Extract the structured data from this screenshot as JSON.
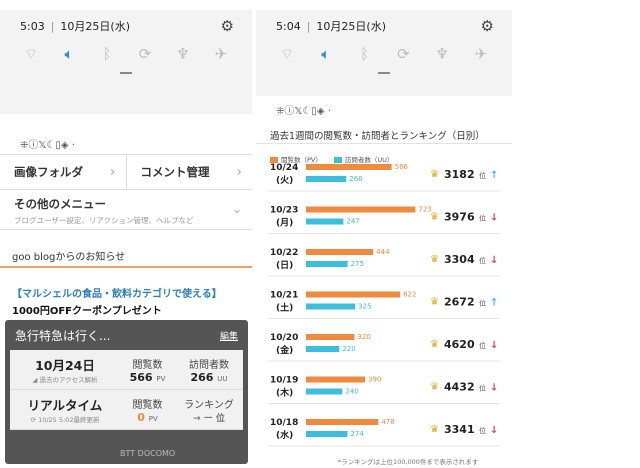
{
  "left": {
    "status": {
      "time": "5:03",
      "date": "10月25日(水)"
    },
    "notif_icons": "⁜ⓘ𝕏☾▯◈ ·",
    "grid": [
      {
        "label": "画像フォルダ"
      },
      {
        "label": "コメント管理"
      }
    ],
    "other_menu": {
      "title": "その他のメニュー",
      "subtitle": "ブログユーザー設定、リアクション管理、ヘルプなど"
    },
    "notice": "goo blogからのお知らせ",
    "promo": {
      "line1": "【マルシェルの食品・飲料カテゴリで使える】",
      "line2": "1000円OFFクーポンプレゼント"
    },
    "box": {
      "title": "急行特急は行く...",
      "edit": "編集",
      "row1": {
        "date": "10月24日",
        "sub": "過去のアクセス解析",
        "pv_label": "閲覧数",
        "pv_value": "566",
        "pv_unit": "PV",
        "uu_label": "訪問者数",
        "uu_value": "266",
        "uu_unit": "UU"
      },
      "row2": {
        "title": "リアルタイム",
        "sub": "10/25 5:02最終更新",
        "pv_label": "閲覧数",
        "pv_value": "0",
        "pv_unit": "PV",
        "rank_label": "ランキング",
        "rank_value": "→ ー 位"
      }
    },
    "watermark": "BTT DOCOMO"
  },
  "right": {
    "status": {
      "time": "5:04",
      "date": "10月25日(水)"
    },
    "notif_icons": "⁜ⓘ𝕏☾▯◈ ·",
    "title": "過去1週間の閲覧数・訪問者とランキング（日別）",
    "legend": {
      "pv": "閲覧数（PV）",
      "uu": "訪問者数（UU）"
    },
    "footnote": "*ランキングは上位100,000件まで表示されます"
  },
  "colors": {
    "pv": "#f08a3e",
    "uu": "#3cbedc",
    "up": "#3cbedc",
    "down": "#e2463d",
    "crown": "#e8a61c",
    "accent": "#2d8fe0"
  },
  "chart_data": {
    "type": "bar",
    "orientation": "horizontal",
    "categories": [
      "10/24",
      "10/23",
      "10/22",
      "10/21",
      "10/20",
      "10/19",
      "10/18"
    ],
    "weekdays": [
      "(火)",
      "(月)",
      "(日)",
      "(土)",
      "(金)",
      "(木)",
      "(水)"
    ],
    "series": [
      {
        "name": "閲覧数（PV）",
        "values": [
          566,
          723,
          444,
          622,
          320,
          390,
          478
        ]
      },
      {
        "name": "訪問者数（UU）",
        "values": [
          266,
          247,
          275,
          325,
          220,
          240,
          274
        ]
      }
    ],
    "ranks": [
      3182,
      3976,
      3304,
      2672,
      4620,
      4432,
      3341
    ],
    "rank_unit": "位",
    "trend": [
      "up",
      "down",
      "down",
      "up",
      "down",
      "down",
      "down"
    ],
    "xlim": [
      0,
      780
    ]
  }
}
